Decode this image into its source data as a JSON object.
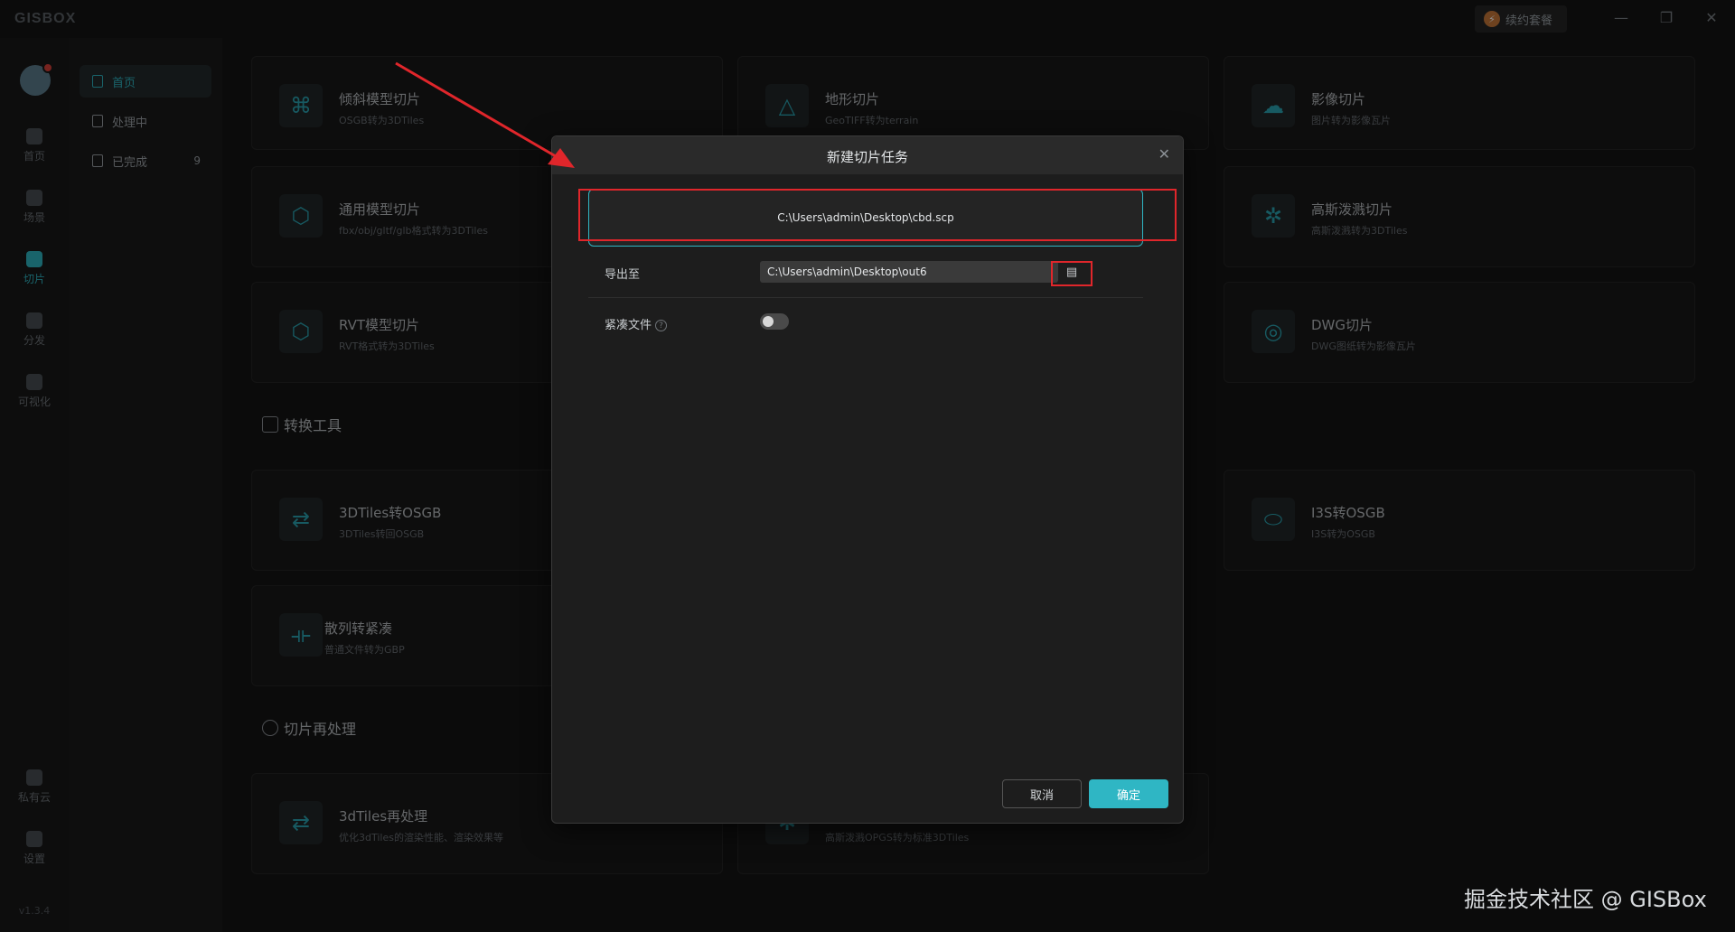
{
  "app": {
    "logo": "GISBOX",
    "renew_label": "续约套餐",
    "window_controls": [
      "—",
      "❐",
      "✕"
    ]
  },
  "rail": {
    "items": [
      {
        "label": "首页",
        "icon": "home-icon"
      },
      {
        "label": "场景",
        "icon": "scene-icon"
      },
      {
        "label": "切片",
        "icon": "slice-icon"
      },
      {
        "label": "分发",
        "icon": "distribute-icon"
      },
      {
        "label": "可视化",
        "icon": "visual-icon"
      },
      {
        "label": "私有云",
        "icon": "cloud-icon"
      },
      {
        "label": "设置",
        "icon": "gear-icon"
      }
    ],
    "version": "v1.3.4"
  },
  "subnav": {
    "items": [
      {
        "label": "首页"
      },
      {
        "label": "处理中"
      },
      {
        "label": "已完成",
        "count": "9"
      }
    ]
  },
  "cards": [
    {
      "title": "倾斜模型切片",
      "sub": "OSGB转为3DTiles"
    },
    {
      "title": "地形切片",
      "sub": "GeoTIFF转为terrain"
    },
    {
      "title": "影像切片",
      "sub": "图片转为影像瓦片"
    },
    {
      "title": "通用模型切片",
      "sub": "fbx/obj/gltf/glb格式转为3DTiles"
    },
    {
      "title": "高斯泼溅切片",
      "sub": "高斯泼溅转为3DTiles"
    },
    {
      "title": "RVT模型切片",
      "sub": "RVT格式转为3DTiles"
    },
    {
      "title": "DWG切片",
      "sub": "DWG图纸转为影像瓦片"
    },
    {
      "title": "3DTiles转OSGB",
      "sub": "3DTiles转回OSGB"
    },
    {
      "title": "I3S转OSGB",
      "sub": "I3S转为OSGB"
    },
    {
      "title": "散列转紧凑",
      "sub": "普通文件转为GBP"
    },
    {
      "title": "3dTiles再处理",
      "sub": "优化3dTiles的渲染性能、渲染效果等"
    },
    {
      "sub": "高斯泼溅OPGS转为标准3DTiles"
    }
  ],
  "sections": {
    "convert": "转换工具",
    "reprocess": "切片再处理"
  },
  "dialog": {
    "title": "新建切片任务",
    "input_path": "C:\\Users\\admin\\Desktop\\cbd.scp",
    "export_label": "导出至",
    "export_path": "C:\\Users\\admin\\Desktop\\out6",
    "compact_label": "紧凑文件",
    "help_glyph": "?",
    "cancel": "取消",
    "ok": "确定"
  },
  "watermark": "掘金技术社区 @ GISBox",
  "colors": {
    "accent": "#2fb6c4",
    "highlight": "#e0262b"
  }
}
